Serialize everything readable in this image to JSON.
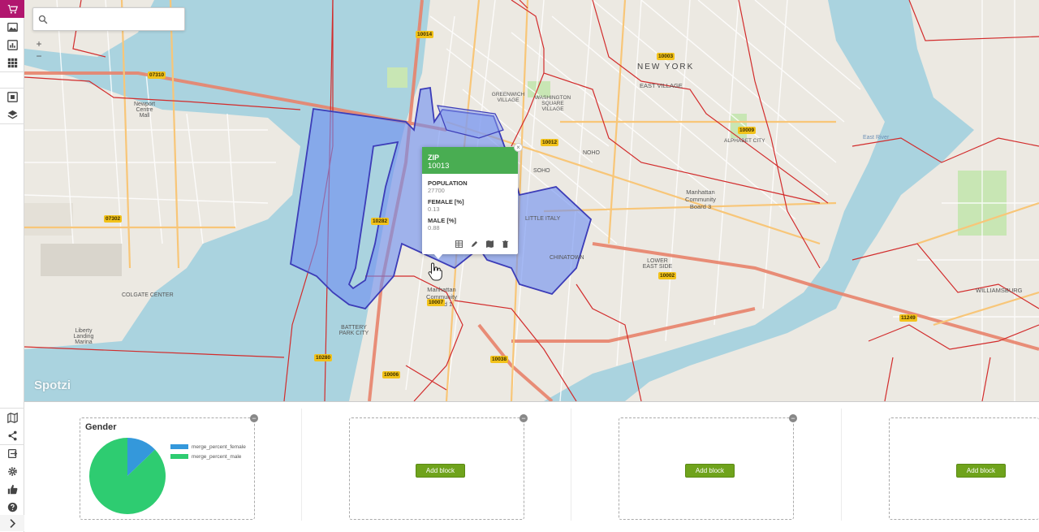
{
  "app": {
    "logo": "Spotzi",
    "accent": "#b1166e"
  },
  "rail": {
    "top": [
      "cart-icon",
      "image-icon",
      "chart-icon",
      "grid-icon",
      "select-icon",
      "layers-icon"
    ],
    "bottom": [
      "map-icon",
      "share-icon",
      "logout-icon",
      "gear-icon",
      "thumbs-up-icon",
      "help-icon",
      "chevron-right-icon"
    ]
  },
  "search": {
    "placeholder": "",
    "value": ""
  },
  "zoom": {
    "in": "+",
    "out": "−"
  },
  "map": {
    "labels": {
      "new_york": "NEW YORK",
      "east_village": "EAST VILLAGE",
      "greenwich_village": "GREENWICH VILLAGE",
      "washington_square": "WASHINGTON SQUARE VILLAGE",
      "soho": "SOHO",
      "noho": "NOHO",
      "little_italy": "LITTLE ITALY",
      "chinatown": "CHINATOWN",
      "alphabet_city": "ALPHABET CITY",
      "lower_east_side": "LOWER EAST SIDE",
      "battery_park": "BATTERY PARK CITY",
      "east_river": "East River",
      "manhattan_cb1": "Manhattan Community Board 1",
      "manhattan_cb3": "Manhattan Community Board 3",
      "williamsburg": "WILLIAMSBURG",
      "colgate": "COLGATE CENTER",
      "liberty": "Liberty Landing Marina",
      "newport": "Newport Centre Mall"
    },
    "zips": [
      "10014",
      "07310",
      "10003",
      "10009",
      "10012",
      "10282",
      "07302",
      "10002",
      "10007",
      "10280",
      "10038",
      "10006",
      "11249"
    ]
  },
  "popup": {
    "header_key": "ZIP",
    "header_value": "10013",
    "fields": [
      {
        "key": "POPULATION",
        "value": "27700"
      },
      {
        "key": "FEMALE [%]",
        "value": "0.13"
      },
      {
        "key": "MALE [%]",
        "value": "0.88"
      }
    ],
    "close": "×",
    "tools": [
      "table-icon",
      "edit-icon",
      "map-icon",
      "trash-icon"
    ]
  },
  "dashboard": {
    "blocks": [
      {
        "title": "Gender",
        "chart_data": {
          "type": "pie",
          "categories": [
            "merge_percent_female",
            "merge_percent_male"
          ],
          "values": [
            0.13,
            0.88
          ],
          "colors": [
            "#3498db",
            "#2ecc71"
          ],
          "legend": "right"
        }
      },
      {
        "button": "Add block"
      },
      {
        "button": "Add block"
      },
      {
        "button": "Add block"
      }
    ],
    "remove": "−"
  }
}
